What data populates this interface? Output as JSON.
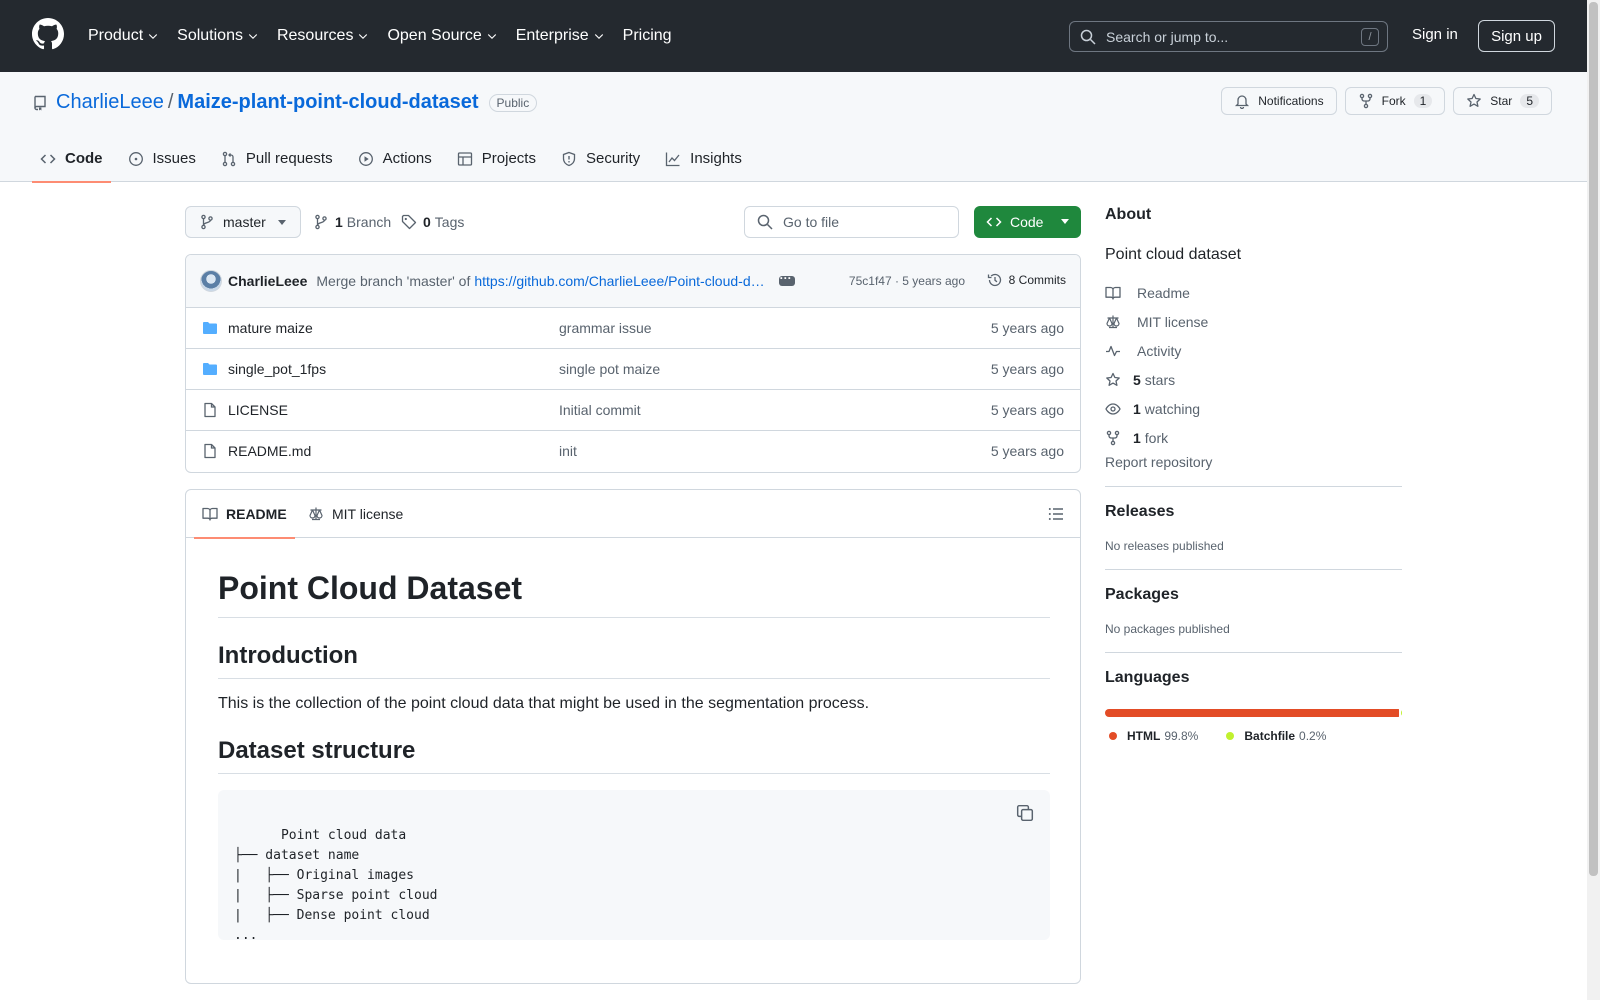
{
  "header": {
    "nav": [
      {
        "label": "Product",
        "dropdown": true
      },
      {
        "label": "Solutions",
        "dropdown": true
      },
      {
        "label": "Resources",
        "dropdown": true
      },
      {
        "label": "Open Source",
        "dropdown": true
      },
      {
        "label": "Enterprise",
        "dropdown": true
      },
      {
        "label": "Pricing",
        "dropdown": false
      }
    ],
    "search_placeholder": "Search or jump to...",
    "search_shortcut": "/",
    "sign_in": "Sign in",
    "sign_up": "Sign up"
  },
  "repo": {
    "owner": "CharlieLeee",
    "separator": "/",
    "name": "Maize-plant-point-cloud-dataset",
    "visibility": "Public",
    "notifications_label": "Notifications",
    "fork_label": "Fork",
    "fork_count": "1",
    "star_label": "Star",
    "star_count": "5",
    "tabs": [
      {
        "label": "Code",
        "icon": "code-icon",
        "active": true
      },
      {
        "label": "Issues",
        "icon": "issue-icon",
        "active": false
      },
      {
        "label": "Pull requests",
        "icon": "pull-request-icon",
        "active": false
      },
      {
        "label": "Actions",
        "icon": "play-icon",
        "active": false
      },
      {
        "label": "Projects",
        "icon": "table-icon",
        "active": false
      },
      {
        "label": "Security",
        "icon": "shield-icon",
        "active": false
      },
      {
        "label": "Insights",
        "icon": "graph-icon",
        "active": false
      }
    ]
  },
  "branchbar": {
    "branch": "master",
    "branch_count": "1",
    "branch_label": "Branch",
    "tag_count": "0",
    "tag_label": "Tags",
    "goto_placeholder": "Go to file",
    "code_button": "Code"
  },
  "commit": {
    "author": "CharlieLeee",
    "message": "Merge branch 'master' of",
    "link": "https://github.com/CharlieLeee/Point-cloud-d…",
    "meta": "75c1f47 · 5 years ago",
    "count": "8 Commits"
  },
  "files": [
    {
      "name": "mature maize",
      "type": "folder",
      "message": "grammar issue",
      "date": "5 years ago"
    },
    {
      "name": "single_pot_1fps",
      "type": "folder",
      "message": "single pot maize",
      "date": "5 years ago"
    },
    {
      "name": "LICENSE",
      "type": "file",
      "message": "Initial commit",
      "date": "5 years ago"
    },
    {
      "name": "README.md",
      "type": "file",
      "message": "init",
      "date": "5 years ago"
    }
  ],
  "readme": {
    "tab_readme": "README",
    "tab_license": "MIT license",
    "h1": "Point Cloud Dataset",
    "h2_intro": "Introduction",
    "intro_text": "This is the collection of the point cloud data that might be used in the segmentation process.",
    "h2_structure": "Dataset structure",
    "code": "Point cloud data\n├── dataset name\n|   ├── Original images\n|   ├── Sparse point cloud\n|   ├── Dense point cloud\n..."
  },
  "sidebar": {
    "about_title": "About",
    "description": "Point cloud dataset",
    "items": [
      {
        "icon": "book-icon",
        "bold": "",
        "label": "Readme"
      },
      {
        "icon": "law-icon",
        "bold": "",
        "label": "MIT license"
      },
      {
        "icon": "pulse-icon",
        "bold": "",
        "label": "Activity"
      },
      {
        "icon": "star-icon",
        "bold": "5",
        "label": "stars"
      },
      {
        "icon": "eye-icon",
        "bold": "1",
        "label": "watching"
      },
      {
        "icon": "fork-icon",
        "bold": "1",
        "label": "fork"
      }
    ],
    "report": "Report repository",
    "releases_title": "Releases",
    "releases_text": "No releases published",
    "packages_title": "Packages",
    "packages_text": "No packages published",
    "languages_title": "Languages",
    "languages": [
      {
        "name": "HTML",
        "percent": "99.8%",
        "value": 99.8,
        "color": "#e34c26"
      },
      {
        "name": "Batchfile",
        "percent": "0.2%",
        "value": 0.2,
        "color": "#c1f12e"
      }
    ]
  }
}
